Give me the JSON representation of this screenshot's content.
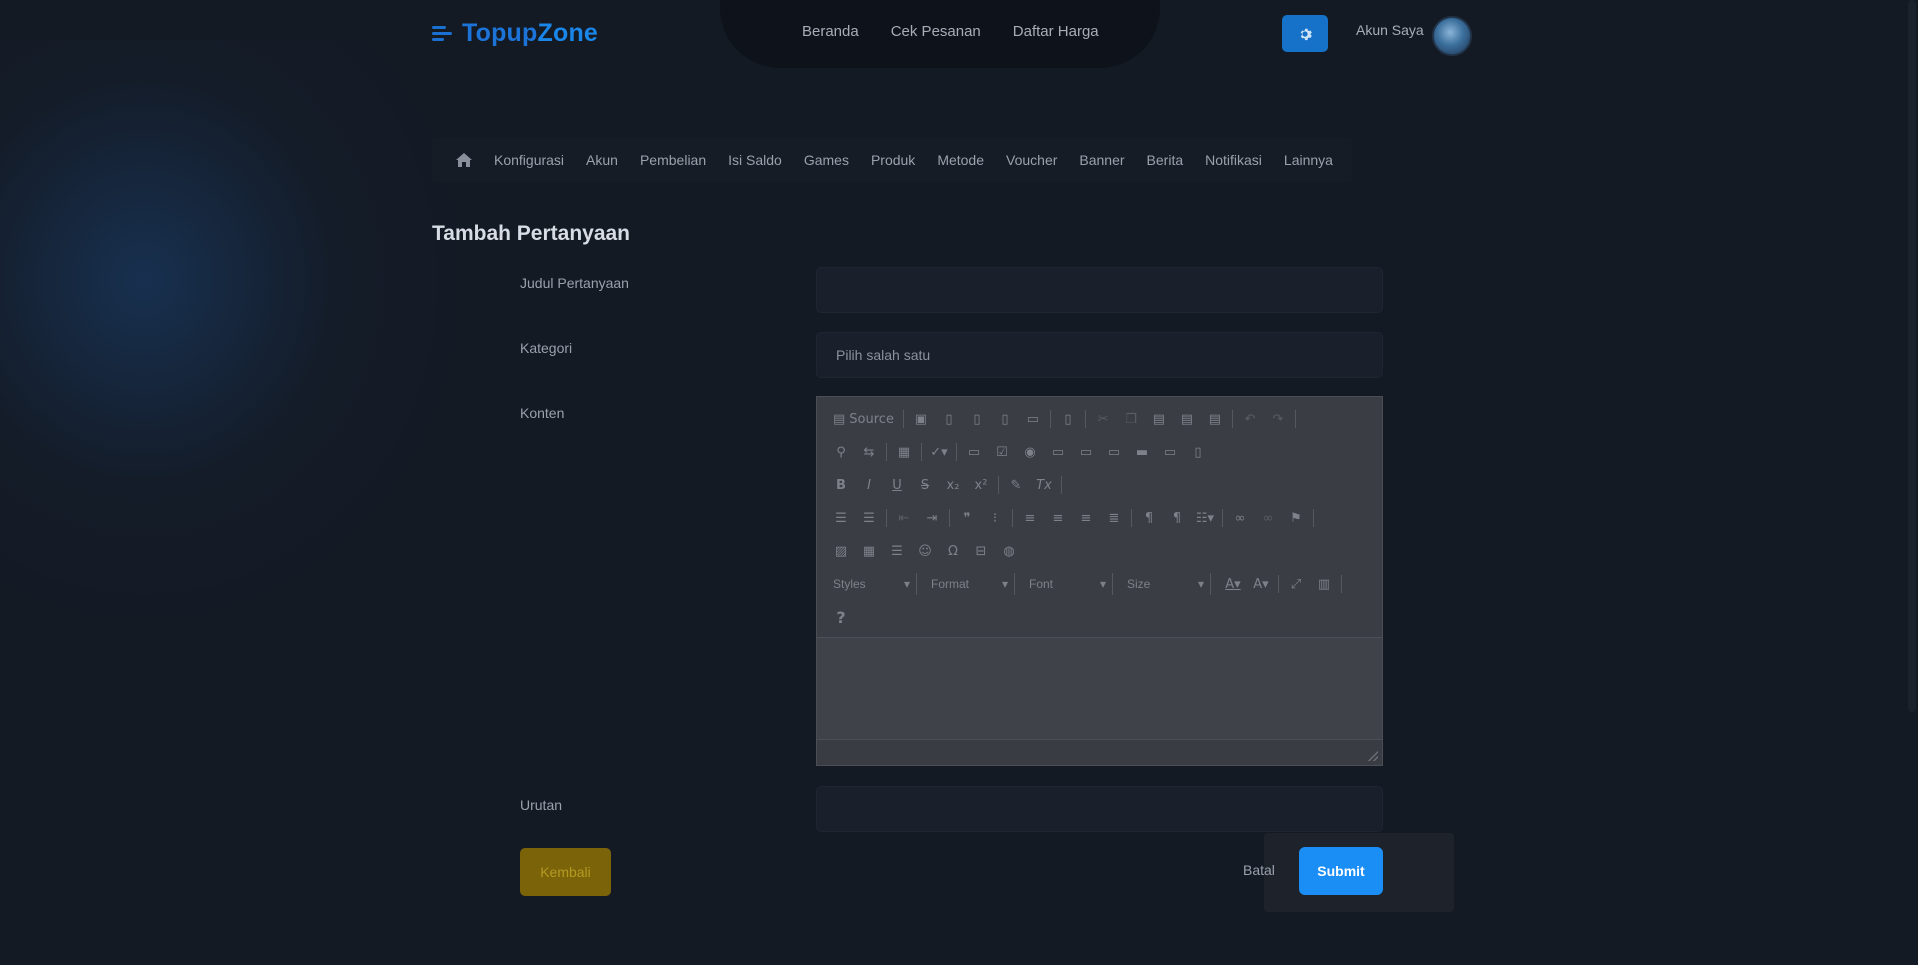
{
  "header": {
    "logo_part1": "Topup",
    "logo_part2": "Zone",
    "nav": [
      "Beranda",
      "Cek Pesanan",
      "Daftar Harga"
    ],
    "account_label": "Akun Saya"
  },
  "subnav": {
    "items": [
      "Konfigurasi",
      "Akun",
      "Pembelian",
      "Isi Saldo",
      "Games",
      "Produk",
      "Metode",
      "Voucher",
      "Banner",
      "Berita",
      "Notifikasi",
      "Lainnya"
    ]
  },
  "page": {
    "title": "Tambah Pertanyaan"
  },
  "form": {
    "judul_label": "Judul Pertanyaan",
    "judul_value": "",
    "kategori_label": "Kategori",
    "kategori_value": "Pilih salah satu",
    "konten_label": "Konten",
    "urutan_label": "Urutan",
    "urutan_value": ""
  },
  "editor": {
    "source_label": "Source",
    "combos": [
      "Styles",
      "Format",
      "Font",
      "Size"
    ],
    "help_label": "?"
  },
  "actions": {
    "back_label": "Kembali",
    "cancel_label": "Batal",
    "submit_label": "Submit"
  },
  "colors": {
    "brand": "#1b8ef5",
    "back_button": "#7a6309",
    "background": "#141a24"
  },
  "icons": [
    "home-icon",
    "gear-icon",
    "avatar"
  ]
}
